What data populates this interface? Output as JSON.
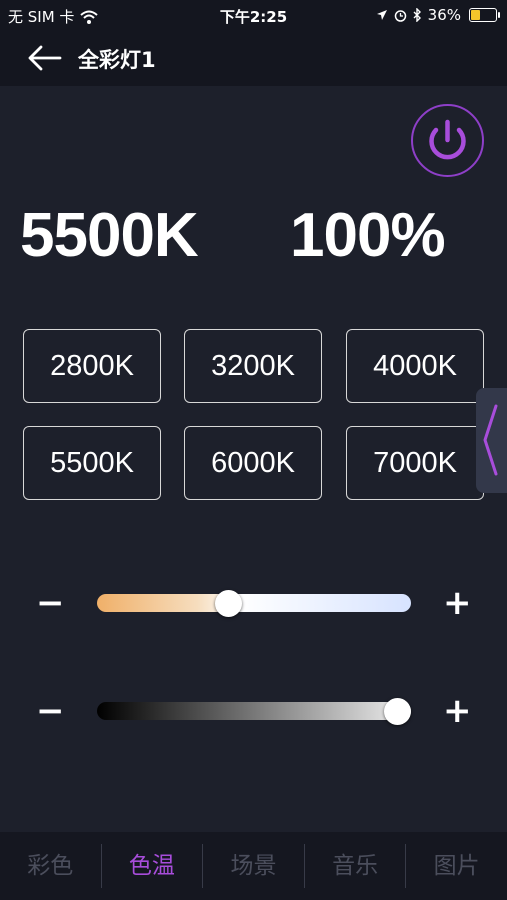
{
  "status_bar": {
    "carrier": "无 SIM 卡",
    "time": "下午2:25",
    "battery_percent": "36%",
    "battery_level": 0.36
  },
  "header": {
    "title": "全彩灯1"
  },
  "readout": {
    "temperature": "5500K",
    "brightness": "100%"
  },
  "presets": [
    "2800K",
    "3200K",
    "4000K",
    "5500K",
    "6000K",
    "7000K"
  ],
  "sliders": {
    "temperature": {
      "minus": "−",
      "plus": "+",
      "level": 0.41
    },
    "brightness": {
      "minus": "−",
      "plus": "+",
      "level": 1.0
    }
  },
  "tabs": [
    {
      "label": "彩色",
      "active": false
    },
    {
      "label": "色温",
      "active": true
    },
    {
      "label": "场景",
      "active": false
    },
    {
      "label": "音乐",
      "active": false
    },
    {
      "label": "图片",
      "active": false
    }
  ],
  "colors": {
    "accent": "#8e3fc8",
    "active_tab": "#a84ddb",
    "background": "#1d202b"
  },
  "icons": {
    "back": "arrow-left-icon",
    "power": "power-icon",
    "side_handle": "chevron-left-icon"
  }
}
